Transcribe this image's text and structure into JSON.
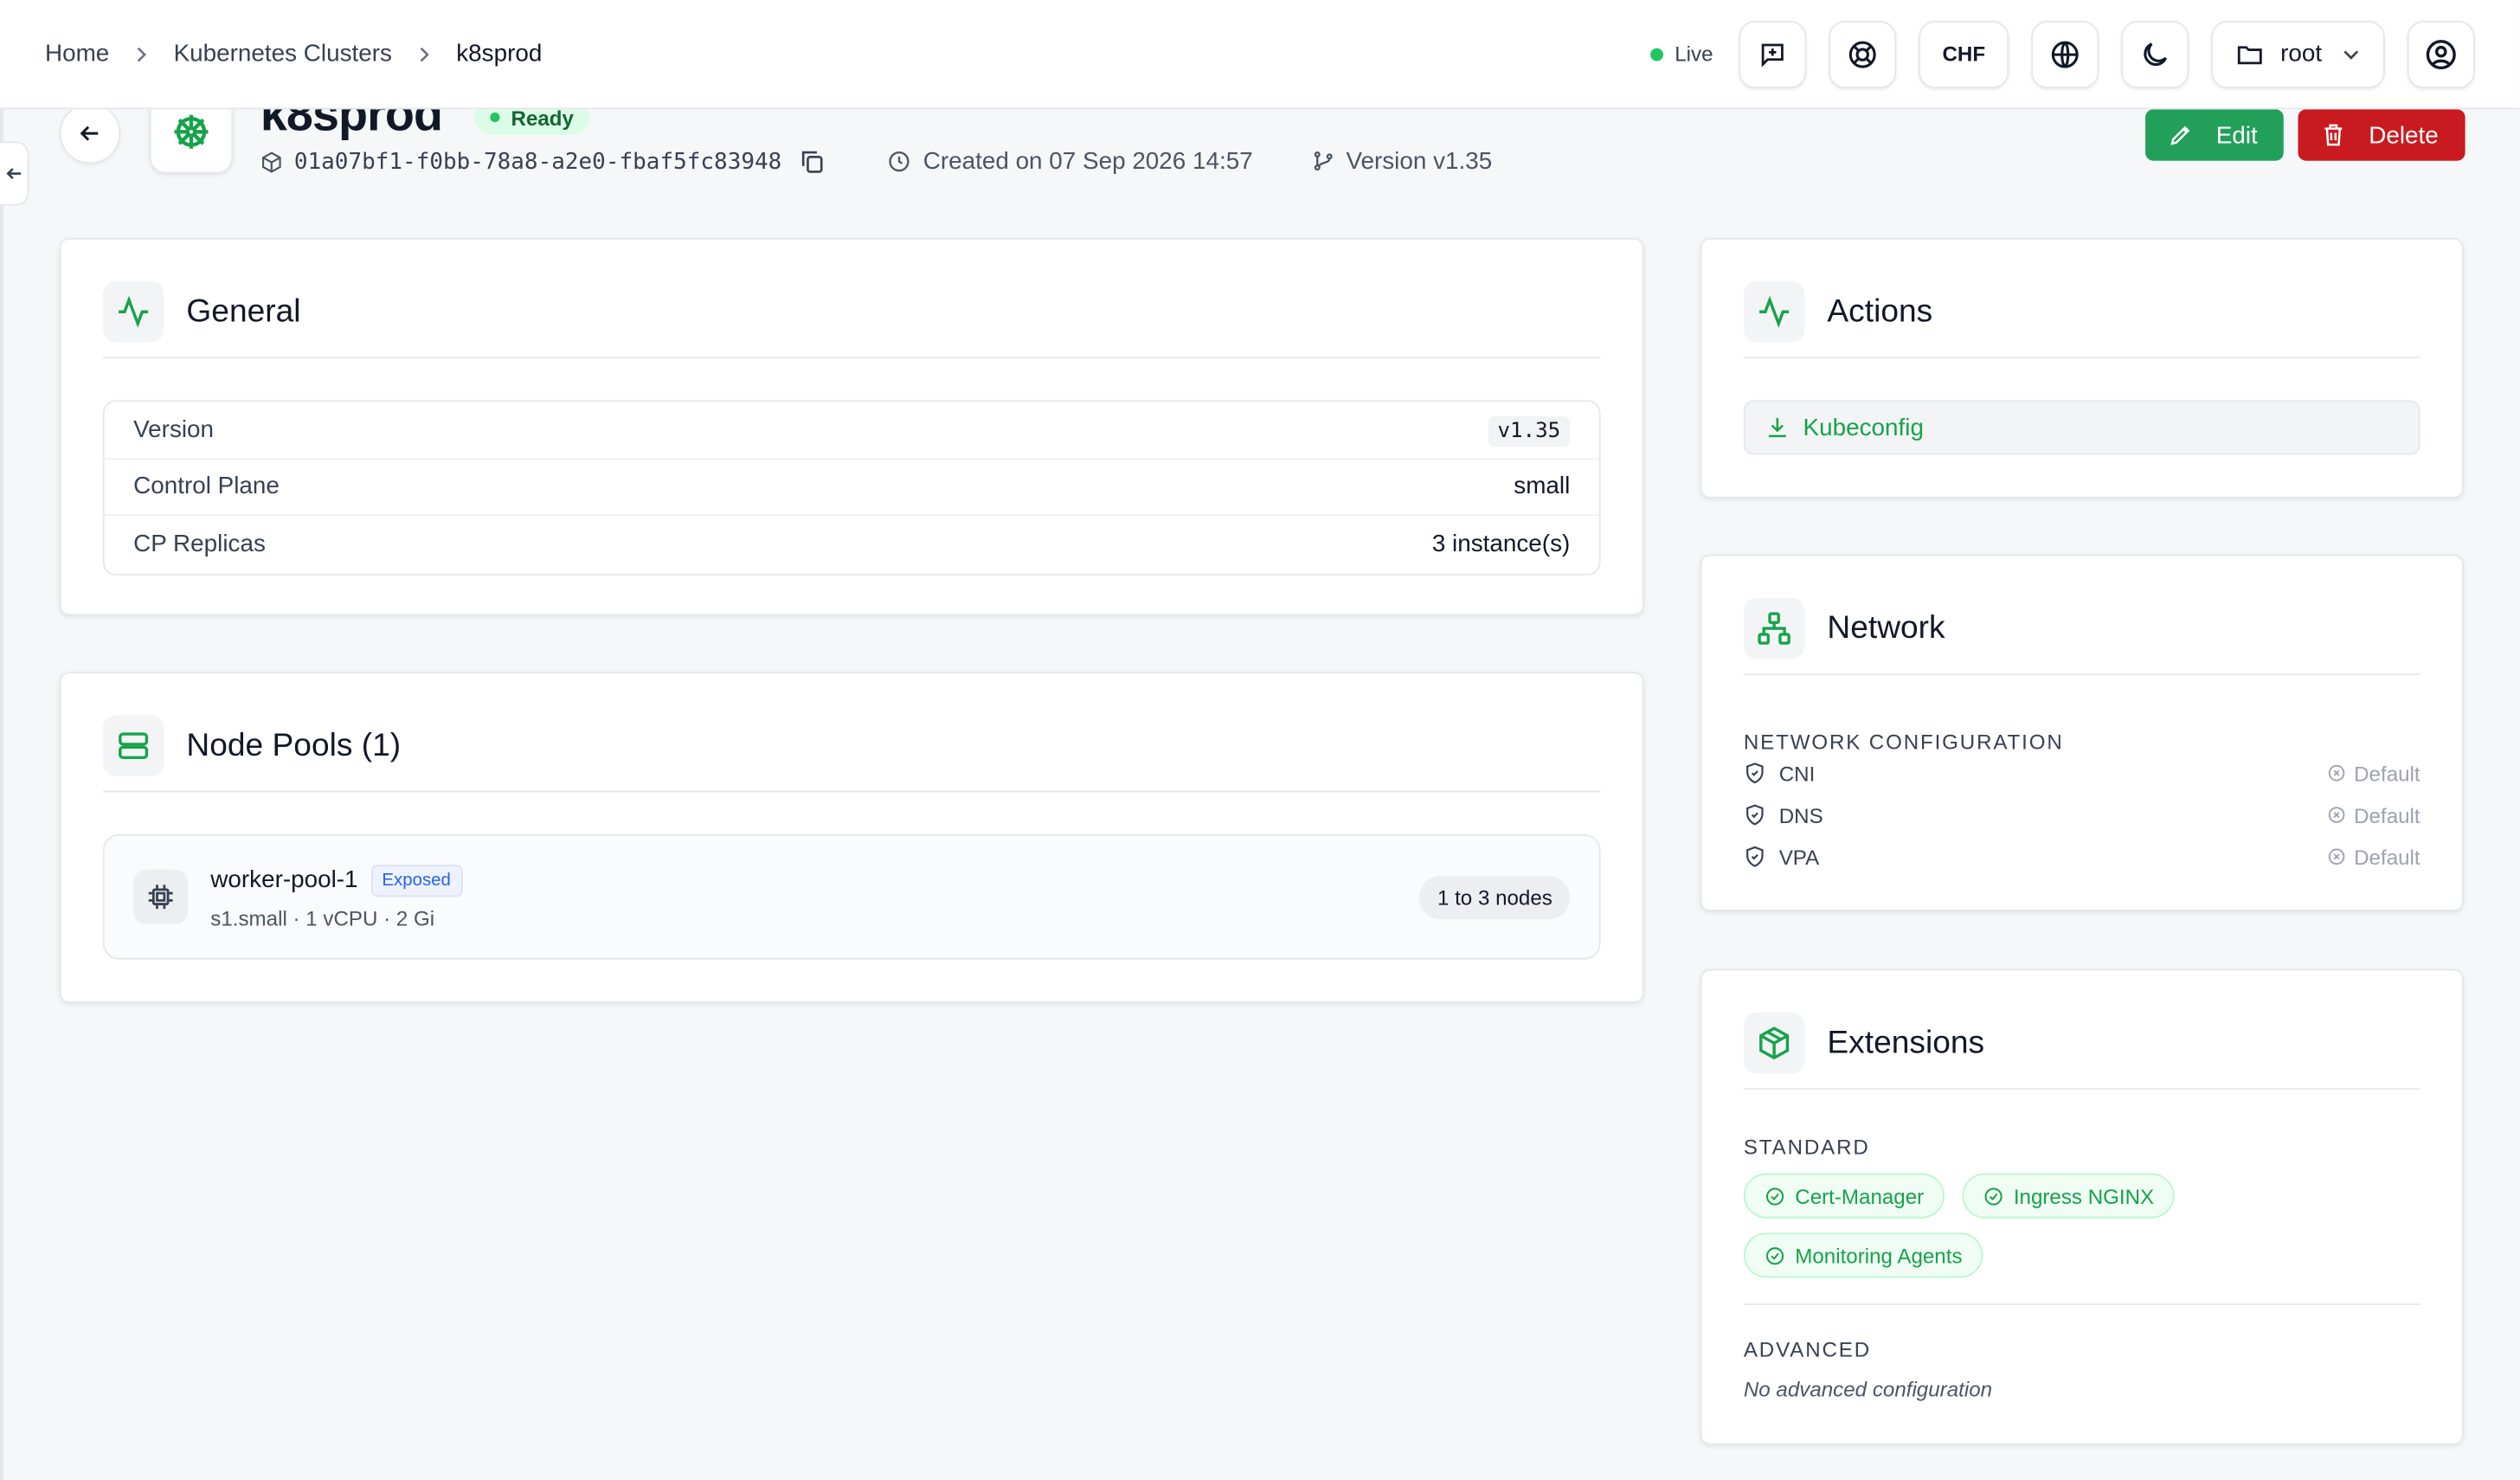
{
  "breadcrumb": [
    "Home",
    "Kubernetes Clusters",
    "k8sprod"
  ],
  "topbar": {
    "live_label": "Live",
    "currency": "CHF",
    "project": "root"
  },
  "cluster": {
    "name": "k8sprod",
    "status": "Ready",
    "uid": "01a07bf1-f0bb-78a8-a2e0-fbaf5fc83948",
    "created": "Created on 07 Sep 2026 14:57",
    "version": "Version v1.35"
  },
  "buttons": {
    "edit": "Edit",
    "delete": "Delete"
  },
  "general": {
    "title": "General",
    "rows": [
      {
        "label": "Version",
        "value": "v1.35"
      },
      {
        "label": "Control Plane",
        "value": "small"
      },
      {
        "label": "CP Replicas",
        "value": "3 instance(s)"
      }
    ]
  },
  "node_pools": {
    "title": "Node Pools (1)",
    "pools": [
      {
        "name": "worker-pool-1",
        "badge": "Exposed",
        "spec": "s1.small · 1 vCPU · 2 Gi",
        "nodes": "1 to 3 nodes"
      }
    ]
  },
  "actions": {
    "title": "Actions",
    "kubeconfig": "Kubeconfig"
  },
  "network": {
    "title": "Network",
    "section": "NETWORK CONFIGURATION",
    "rows": [
      {
        "label": "CNI",
        "value": "Default"
      },
      {
        "label": "DNS",
        "value": "Default"
      },
      {
        "label": "VPA",
        "value": "Default"
      }
    ]
  },
  "extensions": {
    "title": "Extensions",
    "standard_label": "STANDARD",
    "standard": [
      "Cert-Manager",
      "Ingress NGINX",
      "Monitoring Agents"
    ],
    "advanced_label": "ADVANCED",
    "advanced_empty": "No advanced configuration"
  },
  "colors": {
    "accent": "#22a05a",
    "danger": "#c91b1f",
    "status_bg": "#dcfce7"
  }
}
